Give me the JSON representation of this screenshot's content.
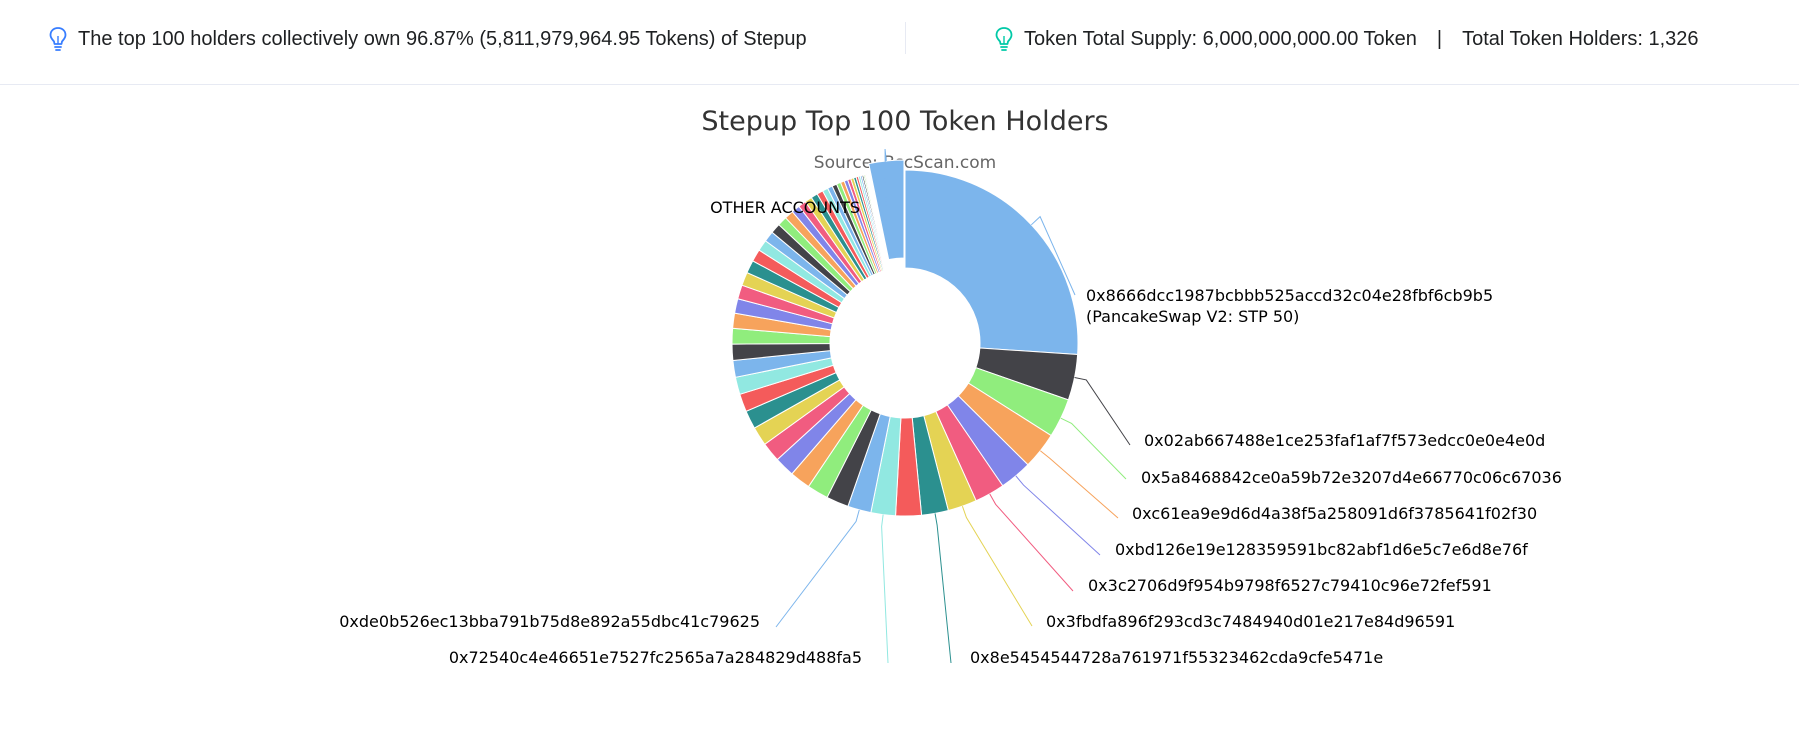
{
  "info": {
    "top_holders_text": "The top 100 holders collectively own 96.87% (5,811,979,964.95 Tokens) of Stepup",
    "total_supply_text": "Token Total Supply: 6,000,000,000.00 Token",
    "separator": "|",
    "total_holders_text": "Total Token Holders: 1,326",
    "icon": "lightbulb-icon",
    "icon_color_left": "#377dff",
    "icon_color_right": "#00c9a7"
  },
  "chart_data": {
    "type": "pie",
    "variant": "donut",
    "title": "Stepup Top 100 Token Holders",
    "subtitle": "Source: BscScan.com",
    "unit": "percent",
    "series": [
      {
        "label": "OTHER ACCOUNTS",
        "value": 3.13,
        "color": "#7cb5ec",
        "labeled": true
      },
      {
        "label": "0x8666dcc1987bcbbb525accd32c04e28fbf6cb9b5",
        "label2": "(PancakeSwap V2: STP 50)",
        "value": 25.0,
        "color": "#7cb5ec",
        "labeled": true
      },
      {
        "label": "0x02ab667488e1ce253faf1af7f573edcc0e0e4e0d",
        "value": 4.1,
        "color": "#434348",
        "labeled": true
      },
      {
        "label": "0x5a8468842ce0a59b72e3207d4e66770c06c67036",
        "value": 3.5,
        "color": "#90ed7d",
        "labeled": true
      },
      {
        "label": "0xc61ea9e9d6d4a38f5a258091d6f3785641f02f30",
        "value": 3.3,
        "color": "#f7a35c",
        "labeled": true
      },
      {
        "label": "0xbd126e19e128359591bc82abf1d6e5c7e6d8e76f",
        "value": 2.9,
        "color": "#8085e9",
        "labeled": true
      },
      {
        "label": "0x3c2706d9f954b9798f6527c79410c96e72fef591",
        "value": 2.7,
        "color": "#f15c80",
        "labeled": true
      },
      {
        "label": "0x3fbdfa896f293cd3c7484940d01e217e84d96591",
        "value": 2.6,
        "color": "#e4d354",
        "labeled": true
      },
      {
        "label": "0x8e5454544728a761971f55323462cda9cfe5471e",
        "value": 2.4,
        "color": "#2b908f",
        "labeled": true
      },
      {
        "label": "",
        "value": 2.3,
        "color": "#f45b5b",
        "labeled": false
      },
      {
        "label": "0x72540c4e46651e7527fc2565a7a284829d488fa5",
        "value": 2.2,
        "color": "#91e8e1",
        "labeled": true
      },
      {
        "label": "0xde0b526ec13bba791b75d8e892a55dbc41c79625",
        "value": 2.1,
        "color": "#7cb5ec",
        "labeled": true
      },
      {
        "label": "",
        "value": 2.0,
        "color": "#434348",
        "labeled": false
      },
      {
        "label": "",
        "value": 1.9,
        "color": "#90ed7d",
        "labeled": false
      },
      {
        "label": "",
        "value": 1.85,
        "color": "#f7a35c",
        "labeled": false
      },
      {
        "label": "",
        "value": 1.8,
        "color": "#8085e9",
        "labeled": false
      },
      {
        "label": "",
        "value": 1.75,
        "color": "#f15c80",
        "labeled": false
      },
      {
        "label": "",
        "value": 1.7,
        "color": "#e4d354",
        "labeled": false
      },
      {
        "label": "",
        "value": 1.65,
        "color": "#2b908f",
        "labeled": false
      },
      {
        "label": "",
        "value": 1.6,
        "color": "#f45b5b",
        "labeled": false
      },
      {
        "label": "",
        "value": 1.55,
        "color": "#91e8e1",
        "labeled": false
      },
      {
        "label": "",
        "value": 1.5,
        "color": "#7cb5ec",
        "labeled": false
      },
      {
        "label": "",
        "value": 1.45,
        "color": "#434348",
        "labeled": false
      },
      {
        "label": "",
        "value": 1.4,
        "color": "#90ed7d",
        "labeled": false
      },
      {
        "label": "",
        "value": 1.35,
        "color": "#f7a35c",
        "labeled": false
      },
      {
        "label": "",
        "value": 1.3,
        "color": "#8085e9",
        "labeled": false
      },
      {
        "label": "",
        "value": 1.25,
        "color": "#f15c80",
        "labeled": false
      },
      {
        "label": "",
        "value": 1.2,
        "color": "#e4d354",
        "labeled": false
      },
      {
        "label": "",
        "value": 1.15,
        "color": "#2b908f",
        "labeled": false
      },
      {
        "label": "",
        "value": 1.1,
        "color": "#f45b5b",
        "labeled": false
      },
      {
        "label": "",
        "value": 1.0,
        "color": "#91e8e1",
        "labeled": false
      },
      {
        "label": "",
        "value": 0.95,
        "color": "#7cb5ec",
        "labeled": false
      },
      {
        "label": "",
        "value": 0.9,
        "color": "#434348",
        "labeled": false
      },
      {
        "label": "",
        "value": 0.85,
        "color": "#90ed7d",
        "labeled": false
      },
      {
        "label": "",
        "value": 0.8,
        "color": "#f7a35c",
        "labeled": false
      },
      {
        "label": "",
        "value": 0.75,
        "color": "#8085e9",
        "labeled": false
      },
      {
        "label": "",
        "value": 0.7,
        "color": "#f15c80",
        "labeled": false
      },
      {
        "label": "",
        "value": 0.65,
        "color": "#e4d354",
        "labeled": false
      },
      {
        "label": "",
        "value": 0.6,
        "color": "#2b908f",
        "labeled": false
      },
      {
        "label": "",
        "value": 0.55,
        "color": "#f45b5b",
        "labeled": false
      },
      {
        "label": "",
        "value": 0.5,
        "color": "#91e8e1",
        "labeled": false
      },
      {
        "label": "",
        "value": 0.45,
        "color": "#7cb5ec",
        "labeled": false
      },
      {
        "label": "",
        "value": 0.42,
        "color": "#434348",
        "labeled": false
      },
      {
        "label": "",
        "value": 0.38,
        "color": "#90ed7d",
        "labeled": false
      },
      {
        "label": "",
        "value": 0.35,
        "color": "#f7a35c",
        "labeled": false
      },
      {
        "label": "",
        "value": 0.32,
        "color": "#8085e9",
        "labeled": false
      },
      {
        "label": "",
        "value": 0.29,
        "color": "#f15c80",
        "labeled": false
      },
      {
        "label": "",
        "value": 0.26,
        "color": "#e4d354",
        "labeled": false
      },
      {
        "label": "",
        "value": 0.23,
        "color": "#2b908f",
        "labeled": false
      },
      {
        "label": "",
        "value": 0.2,
        "color": "#f45b5b",
        "labeled": false
      },
      {
        "label": "",
        "value": 0.18,
        "color": "#91e8e1",
        "labeled": false
      },
      {
        "label": "",
        "value": 0.16,
        "color": "#7cb5ec",
        "labeled": false
      },
      {
        "label": "",
        "value": 0.14,
        "color": "#434348",
        "labeled": false
      },
      {
        "label": "",
        "value": 0.12,
        "color": "#90ed7d",
        "labeled": false
      },
      {
        "label": "",
        "value": 0.1,
        "color": "#f7a35c",
        "labeled": false
      },
      {
        "label": "",
        "value": 0.09,
        "color": "#8085e9",
        "labeled": false
      },
      {
        "label": "",
        "value": 0.08,
        "color": "#f15c80",
        "labeled": false
      },
      {
        "label": "",
        "value": 0.07,
        "color": "#e4d354",
        "labeled": false
      },
      {
        "label": "",
        "value": 0.06,
        "color": "#2b908f",
        "labeled": false
      },
      {
        "label": "",
        "value": 0.05,
        "color": "#f45b5b",
        "labeled": false
      }
    ]
  }
}
